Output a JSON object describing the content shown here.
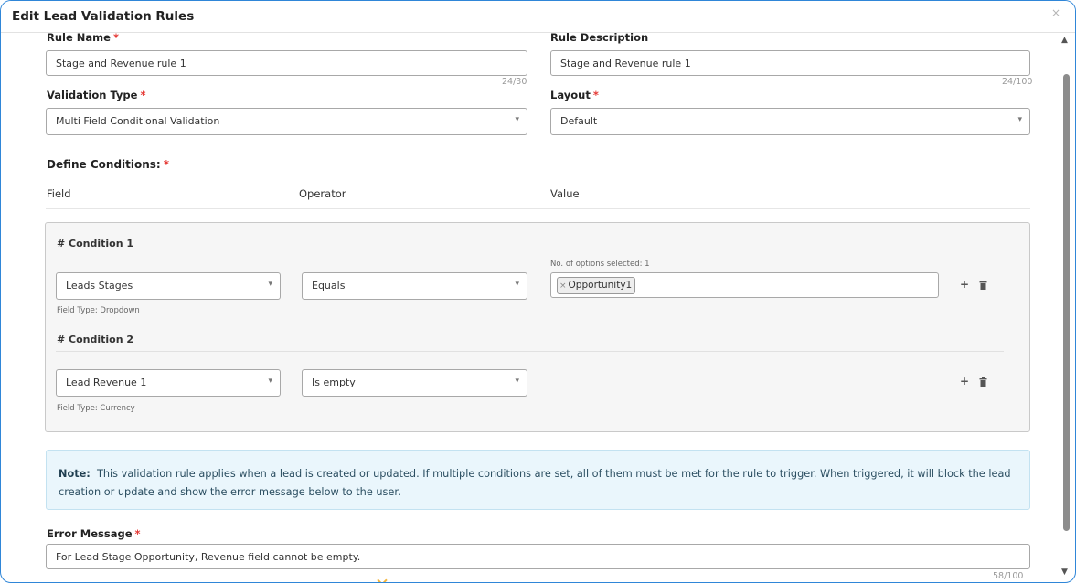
{
  "modal": {
    "title": "Edit Lead Validation Rules",
    "close_glyph": "×"
  },
  "form": {
    "required_mark": "*",
    "rule_name": {
      "label": "Rule Name",
      "value": "Stage and Revenue rule 1",
      "counter": "24/30"
    },
    "rule_description": {
      "label": "Rule Description",
      "value": "Stage and Revenue rule 1",
      "counter": "24/100"
    },
    "validation_type": {
      "label": "Validation Type",
      "value": "Multi Field Conditional Validation"
    },
    "layout": {
      "label": "Layout",
      "value": "Default"
    },
    "define_conditions": {
      "label": "Define Conditions:"
    },
    "columns": {
      "field": "Field",
      "operator": "Operator",
      "value": "Value"
    },
    "conditions": [
      {
        "title": "# Condition 1",
        "field": "Leads Stages",
        "field_type": "Field Type: Dropdown",
        "operator": "Equals",
        "options_selected": "No. of options selected: 1",
        "value_chip": "Opportunity1",
        "chip_remove": "×"
      },
      {
        "title": "# Condition 2",
        "field": "Lead Revenue 1",
        "field_type": "Field Type: Currency",
        "operator": "Is empty"
      }
    ],
    "note": {
      "label": "Note:",
      "text": "This validation rule applies when a lead is created or updated. If multiple conditions are set, all of them must be met for the rule to trigger. When triggered, it will block the lead creation or update and show the error message below to the user."
    },
    "error_message": {
      "label": "Error Message",
      "value": "For Lead Stage Opportunity, Revenue field cannot be empty.",
      "counter": "58/100"
    }
  },
  "icons": {
    "dropdown": "▾",
    "add": "+",
    "scroll_up": "▲",
    "scroll_down": "▼"
  },
  "colors": {
    "accent_border": "#2f86d8",
    "required": "#e53935",
    "note_bg": "#eaf6fc",
    "note_text": "#2b4e61"
  }
}
